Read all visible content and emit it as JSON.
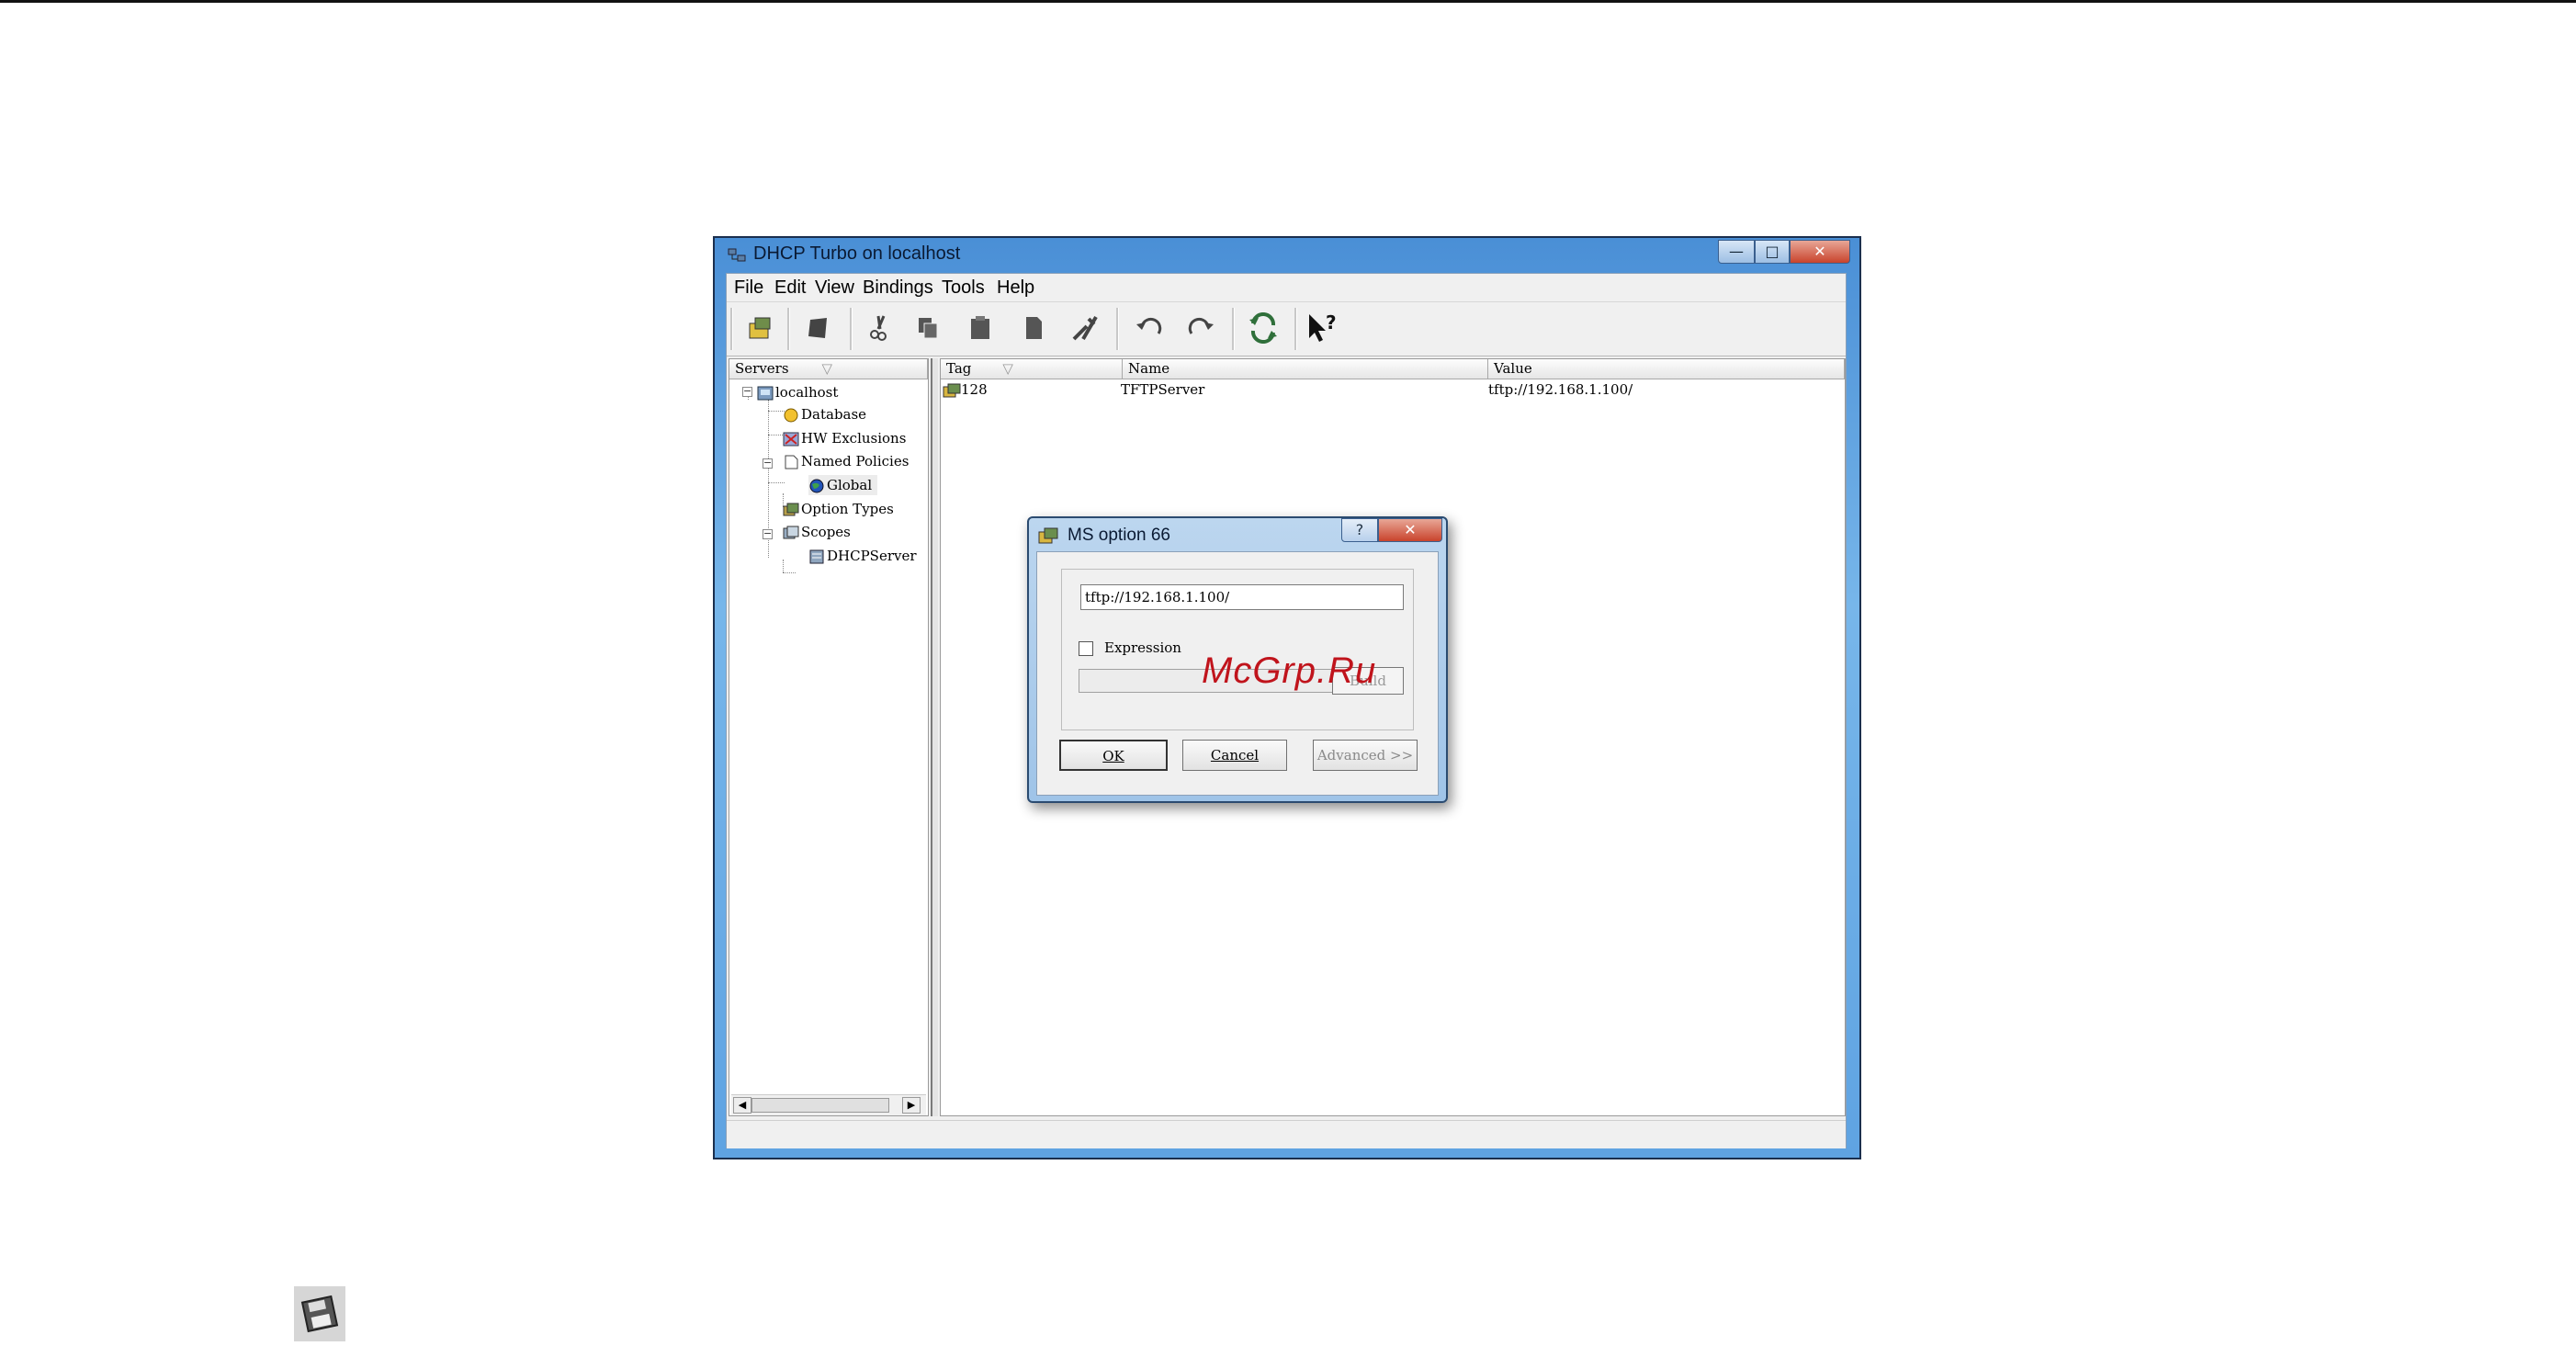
{
  "window": {
    "title": "DHCP Turbo on localhost",
    "min_glyph": "—",
    "max_glyph": "□",
    "close_glyph": "✕"
  },
  "menu": [
    {
      "label": "File"
    },
    {
      "label": "Edit"
    },
    {
      "label": "View"
    },
    {
      "label": "Bindings"
    },
    {
      "label": "Tools"
    },
    {
      "label": "Help"
    }
  ],
  "left_pane": {
    "header": "Servers",
    "tree": [
      {
        "label": "localhost"
      },
      {
        "label": "Database"
      },
      {
        "label": "HW Exclusions"
      },
      {
        "label": "Named Policies"
      },
      {
        "label": "Global"
      },
      {
        "label": "Option Types"
      },
      {
        "label": "Scopes"
      },
      {
        "label": "DHCPServer"
      }
    ]
  },
  "right_pane": {
    "columns": [
      "Tag",
      "Name",
      "Value"
    ],
    "rows": [
      {
        "tag": "128",
        "name": "TFTPServer",
        "value": "tftp://192.168.1.100/"
      }
    ]
  },
  "dialog": {
    "title": "MS option 66",
    "help_glyph": "?",
    "close_glyph": "✕",
    "value": "tftp://192.168.1.100/",
    "expression_label": "Expression",
    "build_label": "Build",
    "ok_label": "OK",
    "cancel_label": "Cancel",
    "advanced_label": "Advanced >>"
  },
  "watermark": "McGrp.Ru",
  "colors": {
    "title_gradient": "#5fa3e2",
    "close_red": "#c9432c",
    "watermark": "#c0141c"
  }
}
